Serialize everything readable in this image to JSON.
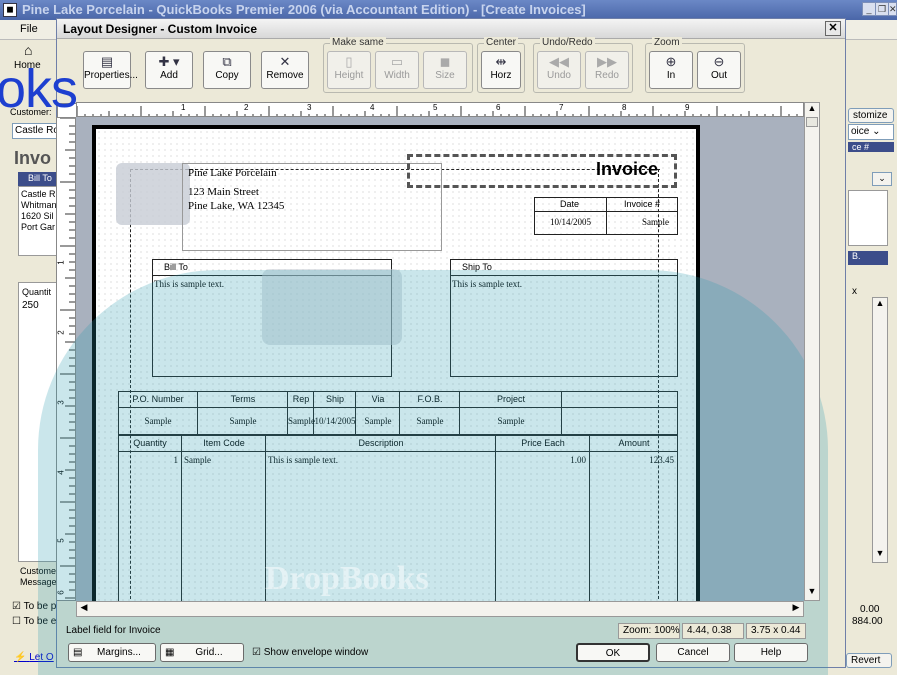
{
  "app": {
    "title": "Pine Lake Porcelain - QuickBooks Premier 2006 (via Accountant Edition) - [Create Invoices]",
    "menu": [
      "File"
    ],
    "left": {
      "home": "Home",
      "customer_label": "Customer:",
      "customer_value": "Castle Ro",
      "invoice_heading": "Invo",
      "bill_to_tab": "Bill To",
      "address": [
        "Castle R",
        "Whitman",
        "1620 Sil",
        "Port Gar"
      ],
      "quantity_label": "Quantit",
      "quantity_value": "250",
      "customer_msg": [
        "Custome",
        "Message"
      ],
      "check1": "To be p",
      "check2": "To be e",
      "let_link": "Let O"
    },
    "right": {
      "customize": "stomize",
      "template": "oice",
      "invoice_num": "ce #",
      "b_label": "B.",
      "x_label": "x",
      "total1": "0.00",
      "total2": "884.00",
      "revert": "Revert"
    }
  },
  "dialog": {
    "title": "Layout Designer - Custom Invoice",
    "toolbar": {
      "properties": "Properties...",
      "add": "Add",
      "copy": "Copy",
      "remove": "Remove",
      "make_same": "Make same",
      "height": "Height",
      "width": "Width",
      "size": "Size",
      "center": "Center",
      "horz": "Horz",
      "undo_redo": "Undo/Redo",
      "undo": "Undo",
      "redo": "Redo",
      "zoom": "Zoom",
      "zoom_in": "In",
      "zoom_out": "Out"
    },
    "ruler_marks": [
      "1",
      "2",
      "3",
      "4",
      "5",
      "6",
      "7",
      "8",
      "9"
    ],
    "vruler_marks": [
      "1",
      "2",
      "3",
      "4",
      "5",
      "6"
    ],
    "invoice": {
      "company": "Pine Lake Porcelain",
      "street": "123 Main Street",
      "city": "Pine Lake, WA 12345",
      "title": "Invoice",
      "date_hdr": "Date",
      "invnum_hdr": "Invoice #",
      "date_val": "10/14/2005",
      "invnum_val": "Sample",
      "bill_to": "Bill To",
      "ship_to": "Ship To",
      "sample_text": "This is sample text.",
      "fields_hdr": [
        "P.O. Number",
        "Terms",
        "Rep",
        "Ship",
        "Via",
        "F.O.B.",
        "Project"
      ],
      "fields_val": [
        "Sample",
        "Sample",
        "Sample",
        "10/14/2005",
        "Sample",
        "Sample",
        "Sample"
      ],
      "items_hdr": [
        "Quantity",
        "Item Code",
        "Description",
        "Price Each",
        "Amount"
      ],
      "items_row": [
        "1",
        "Sample",
        "This is sample text.",
        "1.00",
        "123.45"
      ]
    },
    "status": {
      "label": "Label field for Invoice",
      "zoom": "Zoom: 100%",
      "pos": "4.44, 0.38",
      "size": "3.75 x 0.44"
    },
    "buttons": {
      "margins": "Margins...",
      "grid": "Grid...",
      "envelope": "Show envelope window",
      "ok": "OK",
      "cancel": "Cancel",
      "help": "Help"
    }
  },
  "watermark": {
    "text": "oks",
    "bottom": "DropBooks"
  }
}
